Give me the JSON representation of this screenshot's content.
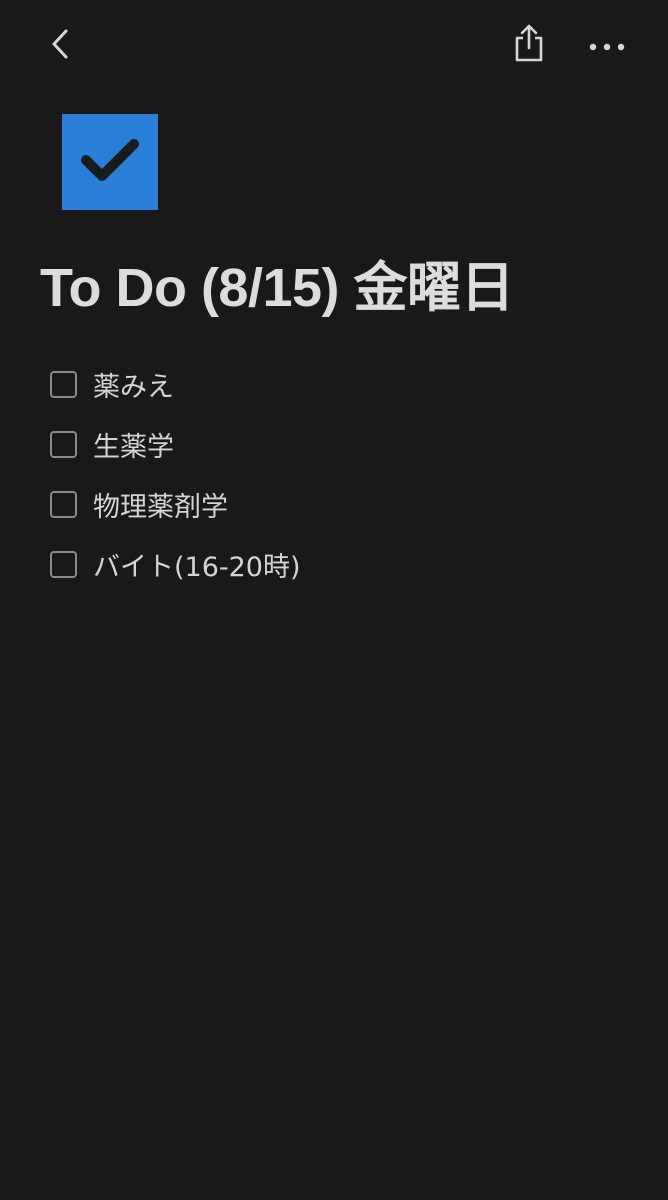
{
  "header": {
    "back_icon": "chevron-left-icon",
    "share_icon": "share-icon",
    "more_icon": "more-horizontal-icon"
  },
  "page": {
    "icon": "checkbox-checked-icon",
    "icon_color": "#2a7fd9",
    "title": "To Do (8/15)  金曜日"
  },
  "todos": [
    {
      "label": "薬みえ",
      "checked": false
    },
    {
      "label": "生薬学",
      "checked": false
    },
    {
      "label": "物理薬剤学",
      "checked": false
    },
    {
      "label": "バイト(16-20時)",
      "checked": false
    }
  ],
  "colors": {
    "background": "#191919",
    "text": "#d4d4d4",
    "accent": "#2a7fd9"
  }
}
